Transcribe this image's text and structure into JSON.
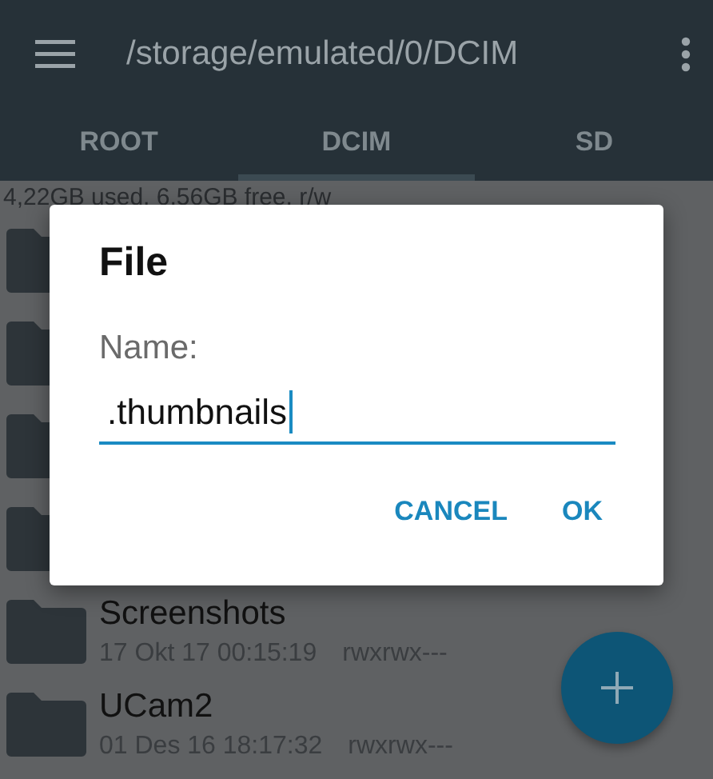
{
  "app_bar": {
    "path": "/storage/emulated/0/DCIM"
  },
  "tabs": [
    {
      "label": "ROOT",
      "selected": false
    },
    {
      "label": "DCIM",
      "selected": true
    },
    {
      "label": "SD",
      "selected": false
    }
  ],
  "storage_info": "4,22GB used, 6,56GB free, r/w",
  "folders": [
    {
      "name": "Screenshots",
      "date": "17 Okt 17 00:15:19",
      "permissions": "rwxrwx---"
    },
    {
      "name": "UCam2",
      "date": "01 Des 16 18:17:32",
      "permissions": "rwxrwx---"
    }
  ],
  "dialog": {
    "title": "File",
    "label": "Name:",
    "value": ".thumbnails",
    "buttons": [
      "CANCEL",
      "OK"
    ]
  }
}
